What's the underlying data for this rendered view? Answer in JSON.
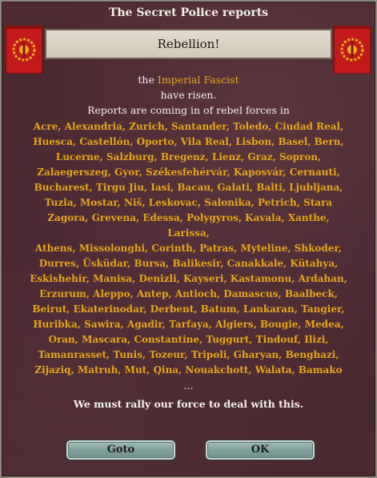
{
  "dialog": {
    "title": "The Secret Police reports",
    "heading": "Rebellion!",
    "intro_the": "the",
    "faction": "Imperial Fascist",
    "have_risen": "have risen.",
    "reports_line": "Reports are coming in of rebel forces in",
    "city_lines": [
      "Acre,  Alexandria,  Zurich,  Santander,  Toledo,  Ciudad Real,",
      "Huesca,  Castellón,  Oporto,  Vila Real,  Lisbon,  Basel,  Bern,",
      "Lucerne,  Salzburg,  Bregenz,  Lienz,  Graz,  Sopron,",
      "Zalaegerszeg,  Gyor,  Székesfehérvár,  Kaposvár,  Cernauti,",
      "Bucharest,  Tirgu Jiu,  Iasi,  Bacau,  Galati,  Balti,  Ljubljana,",
      "Tuzla,  Mostar,  Niš,  Leskovac,  Salonika,  Petrich,  Stara",
      "Zagora,  Grevena,  Edessa,  Polygyros,  Kavala,  Xanthe,  Larissa,",
      "Athens,  Missolonghi,  Corinth,  Patras,  Myteline,  Shkoder,",
      "Durres,  Üsküdar,  Bursa,  Balikesir,  Canakkale,  Kütahya,",
      "Eskishehir,  Manisa,  Denizli,  Kayseri,  Kastamonu,  Ardahan,",
      "Erzurum,  Aleppo,  Antep,  Antioch,  Damascus,  Baalbeck,",
      "Beirut,  Ekaterinodar,  Derbent,  Batum,  Lankaran,  Tangier,",
      "Huribka,  Sawira,  Agadir,  Tarfaya,  Algiers,  Bougie,  Medea,",
      "Oran,  Mascara,  Constantine,  Tuggurt,  Tindouf,  Ilizi,",
      "Tamanrasset,  Tunis,  Tozeur,  Tripoli,  Gharyan,  Benghazi,",
      "Zijaziq,  Matruh,  Mut,  Qina,  Nouakchott,  Walata,  Bamako"
    ],
    "ellipsis": "...",
    "closing": "We must rally our force to deal with this.",
    "goto_label": "Goto",
    "ok_label": "OK"
  },
  "colors": {
    "background": "#4a2a30",
    "highlight_text": "#e6a51a",
    "flag_red": "#c21a1a",
    "emblem_gold": "#e8b020"
  },
  "icons": {
    "flag_left": "fascist-flag-icon",
    "flag_right": "fascist-flag-icon"
  }
}
